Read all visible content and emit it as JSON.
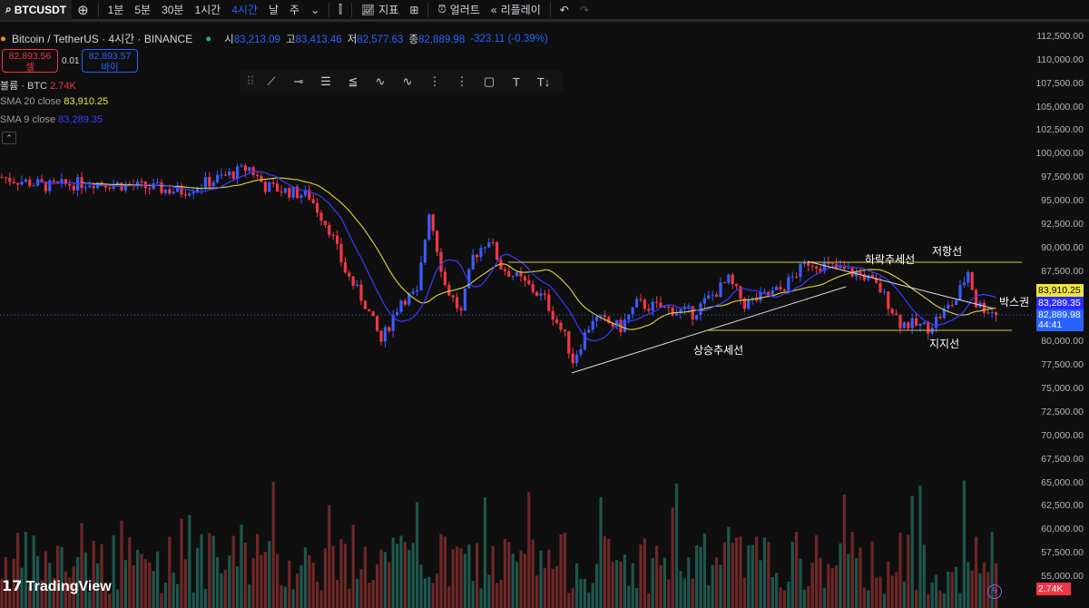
{
  "toolbar": {
    "symbol": "BTCUSDT",
    "intervals": [
      "1분",
      "5분",
      "30분",
      "1시간",
      "4시간",
      "날",
      "주"
    ],
    "active_interval": "4시간",
    "indicators": "지표",
    "alert": "얼러트",
    "replay": "리플레이"
  },
  "legend": {
    "title": "Bitcoin / TetherUS · 4시간 · BINANCE",
    "o_label": "시",
    "o": "83,213.09",
    "h_label": "고",
    "h": "83,413.46",
    "l_label": "저",
    "l": "82,577.63",
    "c_label": "종",
    "c": "82,889.98",
    "change": "-323.11 (-0.39%)"
  },
  "trade": {
    "sell_price": "82,893.56",
    "sell_label": "셀",
    "spread": "0.01",
    "buy_price": "82,893.57",
    "buy_label": "바이"
  },
  "volume": {
    "label": "볼륨 · BTC",
    "value": "2.74K"
  },
  "sma20": {
    "label": "SMA 20 close",
    "value": "83,910.25",
    "color": "#f0e442"
  },
  "sma9": {
    "label": "SMA 9 close",
    "value": "83,289.35",
    "color": "#3b3bff"
  },
  "axis": {
    "ticks": [
      "112,500.00",
      "110,000.00",
      "107,500.00",
      "105,000.00",
      "102,500.00",
      "100,000.00",
      "97,500.00",
      "95,000.00",
      "92,500.00",
      "90,000.00",
      "87,500.00",
      "85,000.00",
      "82,500.00",
      "80,000.00",
      "77,500.00",
      "75,000.00",
      "72,500.00",
      "70,000.00",
      "67,500.00",
      "65,000.00",
      "62,500.00",
      "60,000.00",
      "57,500.00",
      "55,000.00"
    ],
    "sma20_tag": "83,910.25",
    "sma9_tag": "83,289.35",
    "last_price": "82,889.98",
    "countdown": "44:41",
    "volume_tag": "2.74K"
  },
  "annotations": {
    "downtrend": "하락추세선",
    "resistance": "저항선",
    "box": "박스권",
    "uptrend": "상승추세선",
    "support": "지지선"
  },
  "brand": "TradingView",
  "colors": {
    "up": "#3b5bfd",
    "down": "#f23645",
    "sma20": "#d4c83a",
    "sma9": "#3b3bff"
  },
  "price_path": [
    [
      0,
      97500
    ],
    [
      12,
      96500
    ],
    [
      23,
      97000
    ],
    [
      45,
      96000
    ],
    [
      62,
      98500
    ],
    [
      66,
      96500
    ],
    [
      77,
      95500
    ],
    [
      82,
      92000
    ],
    [
      86,
      87500
    ],
    [
      91,
      84000
    ],
    [
      95,
      80000
    ],
    [
      100,
      84500
    ],
    [
      104,
      85000
    ],
    [
      107,
      94000
    ],
    [
      111,
      86000
    ],
    [
      115,
      83000
    ],
    [
      118,
      89000
    ],
    [
      122,
      91000
    ],
    [
      125,
      88000
    ],
    [
      130,
      86500
    ],
    [
      136,
      84500
    ],
    [
      141,
      80500
    ],
    [
      143,
      78000
    ],
    [
      148,
      82500
    ],
    [
      155,
      81500
    ],
    [
      159,
      84000
    ],
    [
      173,
      83000
    ],
    [
      182,
      86500
    ],
    [
      186,
      84000
    ],
    [
      195,
      85500
    ],
    [
      202,
      88500
    ],
    [
      216,
      87000
    ],
    [
      220,
      85500
    ],
    [
      225,
      82000
    ],
    [
      232,
      81500
    ],
    [
      239,
      84500
    ],
    [
      242,
      87500
    ],
    [
      244,
      84000
    ],
    [
      249,
      83000
    ]
  ]
}
